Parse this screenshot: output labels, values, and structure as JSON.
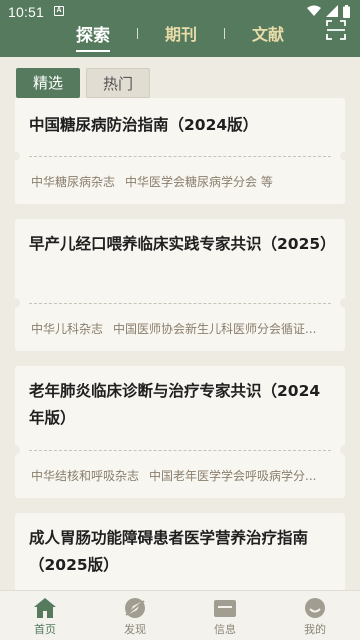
{
  "status": {
    "time": "10:51",
    "a_label": "A"
  },
  "colors": {
    "primary": "#557a5e",
    "tab_inactive": "#e8dca8",
    "background": "#eeebe3"
  },
  "header": {
    "tabs": [
      {
        "label": "探索",
        "active": true
      },
      {
        "label": "期刊",
        "active": false
      },
      {
        "label": "文献",
        "active": false
      }
    ],
    "scan_icon": "scan-icon"
  },
  "subtabs": [
    {
      "label": "精选",
      "active": true
    },
    {
      "label": "热门",
      "active": false
    }
  ],
  "cards": [
    {
      "title": "中国糖尿病防治指南（2024版）",
      "journal": "中华糖尿病杂志",
      "authors": "中华医学会糖尿病学分会 等"
    },
    {
      "title": "早产儿经口喂养临床实践专家共识（2025）",
      "journal": "中华儿科杂志",
      "authors": "中国医师协会新生儿科医师分会循证..."
    },
    {
      "title": "老年肺炎临床诊断与治疗专家共识（2024年版）",
      "journal": "中华结核和呼吸杂志",
      "authors": "中国老年医学学会呼吸病学分..."
    },
    {
      "title": "成人胃肠功能障碍患者医学营养治疗指南（2025版）",
      "journal": "",
      "authors": ""
    }
  ],
  "bottom_nav": [
    {
      "label": "首页",
      "icon": "home-icon",
      "active": true
    },
    {
      "label": "发现",
      "icon": "discover-icon",
      "active": false
    },
    {
      "label": "信息",
      "icon": "mail-icon",
      "active": false
    },
    {
      "label": "我的",
      "icon": "profile-icon",
      "active": false
    }
  ]
}
